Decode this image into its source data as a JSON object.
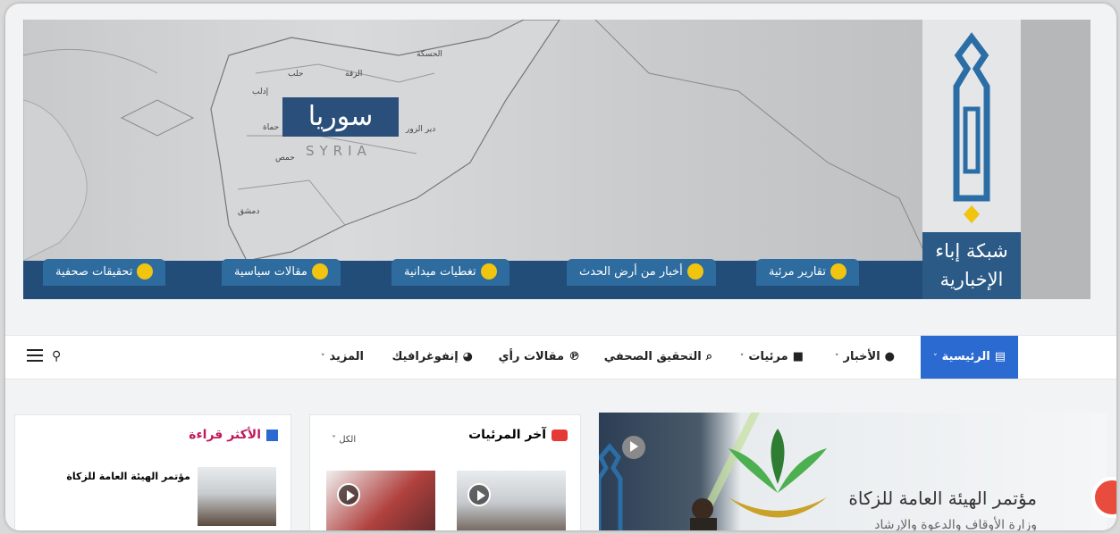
{
  "banner": {
    "country_ar": "سوريا",
    "country_en": "SYRIA",
    "cities": [
      "حلب",
      "الرقة",
      "الحسكة",
      "إدلب",
      "حماة",
      "دير الزور",
      "حمص",
      "دمشق"
    ],
    "logo_text_line1": "شبكة إباء",
    "logo_text_line2": "الإخبارية",
    "tabs": [
      "تقارير مرئية",
      "أخبار من أرض الحدث",
      "تغطيات ميدانية",
      "مقالات سياسية",
      "تحقيقات صحفية"
    ]
  },
  "nav": {
    "items": [
      "الرئيسية",
      "الأخبار",
      "مرئيات",
      "التحقيق الصحفي",
      "مقالات رأي",
      "إنفوغرافيك",
      "المزيد"
    ],
    "search_icon": "search-icon",
    "menu_icon": "hamburger-icon"
  },
  "most_read": {
    "title": "الأكثر قراءة",
    "item_title": "مؤتمر الهيئة العامة للزكاة"
  },
  "latest_videos": {
    "title": "آخر المرئيات",
    "filter": "الكل"
  },
  "hero": {
    "title": "مؤتمر الهيئة العامة للزكاة",
    "subtitle": "وزارة الأوقاف والدعوة والإرشاد"
  },
  "colors": {
    "accent": "#2a6ad1",
    "banner_tab": "#2e6b9e",
    "tab_icon": "#f1c40f",
    "most_read_title": "#c2185b"
  }
}
